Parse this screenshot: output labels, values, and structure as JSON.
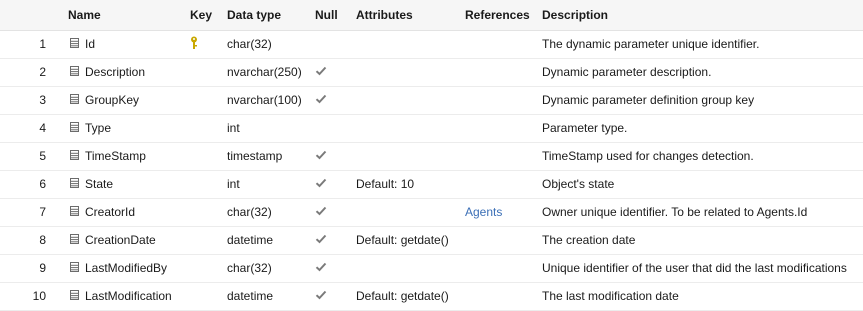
{
  "header": {
    "name": "Name",
    "key": "Key",
    "data_type": "Data type",
    "null": "Null",
    "attributes": "Attributes",
    "references": "References",
    "description": "Description"
  },
  "accent": {
    "link": "#3b6fb6",
    "key_icon": "#c9a800",
    "check": "#7a7a7a"
  },
  "rows": [
    {
      "num": "1",
      "name": "Id",
      "key": true,
      "type": "char(32)",
      "null": false,
      "attributes": "",
      "references": "",
      "description": "The dynamic parameter unique identifier."
    },
    {
      "num": "2",
      "name": "Description",
      "key": false,
      "type": "nvarchar(250)",
      "null": true,
      "attributes": "",
      "references": "",
      "description": "Dynamic parameter description."
    },
    {
      "num": "3",
      "name": "GroupKey",
      "key": false,
      "type": "nvarchar(100)",
      "null": true,
      "attributes": "",
      "references": "",
      "description": "Dynamic parameter definition group key"
    },
    {
      "num": "4",
      "name": "Type",
      "key": false,
      "type": "int",
      "null": false,
      "attributes": "",
      "references": "",
      "description": "Parameter type."
    },
    {
      "num": "5",
      "name": "TimeStamp",
      "key": false,
      "type": "timestamp",
      "null": true,
      "attributes": "",
      "references": "",
      "description": "TimeStamp used for changes detection."
    },
    {
      "num": "6",
      "name": "State",
      "key": false,
      "type": "int",
      "null": true,
      "attributes": "Default: 10",
      "references": "",
      "description": "Object's state"
    },
    {
      "num": "7",
      "name": "CreatorId",
      "key": false,
      "type": "char(32)",
      "null": true,
      "attributes": "",
      "references": "Agents",
      "description": "Owner unique identifier. To be related to Agents.Id"
    },
    {
      "num": "8",
      "name": "CreationDate",
      "key": false,
      "type": "datetime",
      "null": true,
      "attributes": "Default: getdate()",
      "references": "",
      "description": "The creation date"
    },
    {
      "num": "9",
      "name": "LastModifiedBy",
      "key": false,
      "type": "char(32)",
      "null": true,
      "attributes": "",
      "references": "",
      "description": "Unique identifier of the user that did the last modifications"
    },
    {
      "num": "10",
      "name": "LastModification",
      "key": false,
      "type": "datetime",
      "null": true,
      "attributes": "Default: getdate()",
      "references": "",
      "description": "The last modification date"
    }
  ]
}
